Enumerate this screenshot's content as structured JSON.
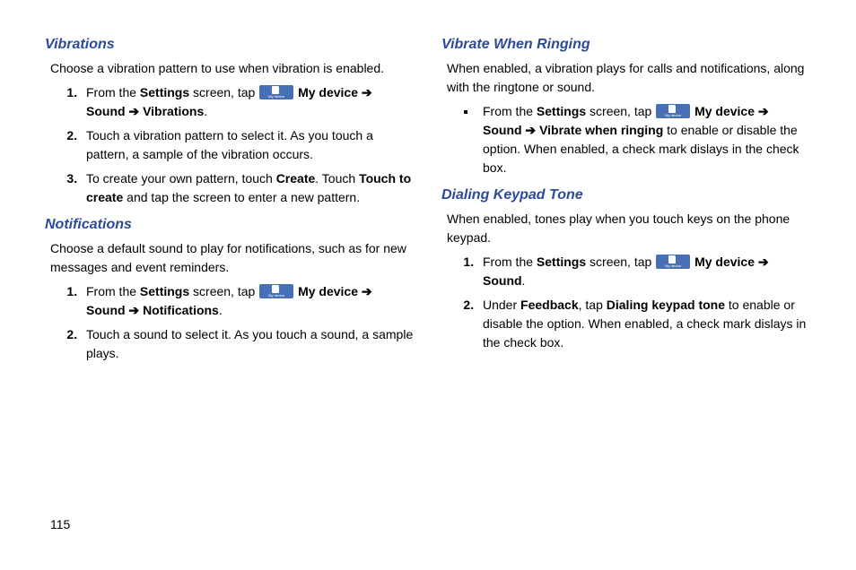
{
  "icon_label": "My device",
  "page_number": "115",
  "left": {
    "s1": {
      "heading": "Vibrations",
      "intro": "Choose a vibration pattern to use when vibration is enabled.",
      "li1_a": "From the ",
      "li1_b": "Settings",
      "li1_c": " screen, tap ",
      "li1_d": "My device",
      "li1_e": " ➔ ",
      "li1_f": "Sound",
      "li1_g": " ➔ ",
      "li1_h": "Vibrations",
      "li1_i": ".",
      "li2": "Touch a vibration pattern to select it. As you touch a pattern, a sample of the vibration occurs.",
      "li3_a": "To create your own pattern, touch ",
      "li3_b": "Create",
      "li3_c": ". Touch ",
      "li3_d": "Touch to create",
      "li3_e": " and tap the screen to enter a new pattern."
    },
    "s2": {
      "heading": "Notifications",
      "intro": "Choose a default sound to play for notifications, such as for new messages and event reminders.",
      "li1_a": "From the ",
      "li1_b": "Settings",
      "li1_c": " screen, tap ",
      "li1_d": "My device",
      "li1_e": " ➔ ",
      "li1_f": "Sound",
      "li1_g": " ➔ ",
      "li1_h": "Notifications",
      "li1_i": ".",
      "li2": "Touch a sound to select it. As you touch a sound, a sample plays."
    }
  },
  "right": {
    "s1": {
      "heading": "Vibrate When Ringing",
      "intro": "When enabled, a vibration plays for calls and notifications, along with the ringtone or sound.",
      "li1_a": "From the ",
      "li1_b": "Settings",
      "li1_c": " screen, tap ",
      "li1_d": "My device",
      "li1_e": " ➔ ",
      "li1_f": "Sound",
      "li1_g": " ➔ ",
      "li1_h": "Vibrate when ringing",
      "li1_i": " to enable or disable the option. When enabled, a check mark dislays in the check box."
    },
    "s2": {
      "heading": "Dialing Keypad Tone",
      "intro": "When enabled, tones play when you touch keys on the phone keypad.",
      "li1_a": "From the ",
      "li1_b": "Settings",
      "li1_c": " screen, tap ",
      "li1_d": "My device",
      "li1_e": " ➔ ",
      "li1_f": "Sound",
      "li1_g": ".",
      "li2_a": "Under ",
      "li2_b": "Feedback",
      "li2_c": ", tap ",
      "li2_d": "Dialing keypad tone",
      "li2_e": " to enable or disable the option. When enabled, a check mark dislays in the check box."
    }
  }
}
